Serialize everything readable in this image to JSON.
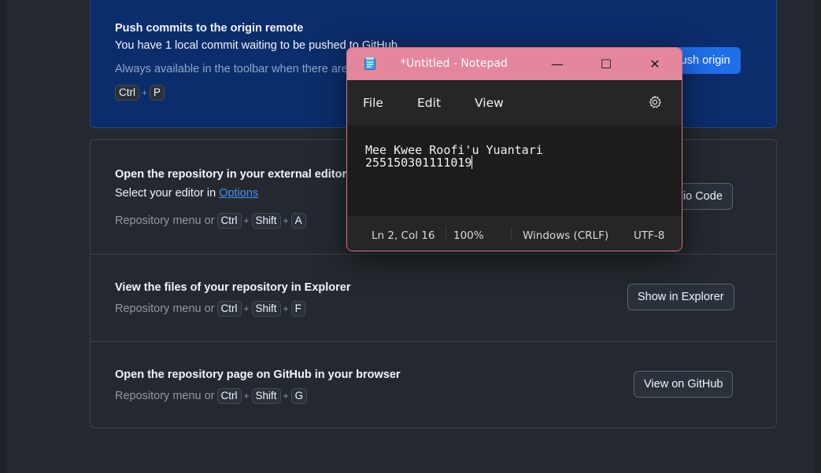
{
  "push": {
    "title": "Push commits to the origin remote",
    "desc": "You have 1 local commit waiting to be pushed to GitHub.",
    "hint": "Always available in the toolbar when there are local commits waiting to be pushed or",
    "shortcut": [
      "Ctrl",
      "P"
    ],
    "button_label": "Push origin"
  },
  "rows": [
    {
      "title": "Open the repository in your external editor",
      "desc_prefix": "Select your editor in ",
      "desc_link": "Options",
      "hint_prefix": "Repository menu or",
      "shortcut": [
        "Ctrl",
        "Shift",
        "A"
      ],
      "button_label": "Open in Visual Studio Code"
    },
    {
      "title": "View the files of your repository in Explorer",
      "hint_prefix": "Repository menu or",
      "shortcut": [
        "Ctrl",
        "Shift",
        "F"
      ],
      "button_label": "Show in Explorer"
    },
    {
      "title": "Open the repository page on GitHub in your browser",
      "hint_prefix": "Repository menu or",
      "shortcut": [
        "Ctrl",
        "Shift",
        "G"
      ],
      "button_label": "View on GitHub"
    }
  ],
  "plus": "+",
  "notepad": {
    "title": "*Untitled - Notepad",
    "controls": {
      "minimize": "—",
      "maximize": "☐",
      "close": "✕"
    },
    "menu": [
      "File",
      "Edit",
      "View"
    ],
    "settings_icon": "gear-icon",
    "lines": [
      "Mee Kwee Roofi'u Yuantari",
      "255150301111019"
    ],
    "status": {
      "position": "Ln 2, Col 16",
      "zoom": "100%",
      "line_ending": "Windows (CRLF)",
      "encoding": "UTF-8"
    },
    "accent": "#e5879c"
  }
}
